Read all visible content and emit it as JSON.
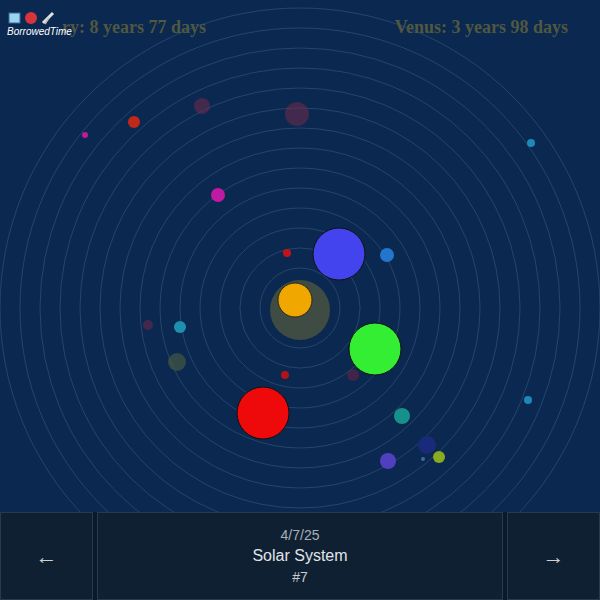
{
  "header": {
    "left_reading": "ry: 8 years 77 days",
    "right_reading": "Venus: 3 years 98 days"
  },
  "logo": {
    "text": "BorrowedTime"
  },
  "planets": [
    {
      "color": "#c0141a",
      "faded": false
    },
    {
      "color": "#b0141a",
      "faded": false
    },
    {
      "color": "#4444ee",
      "faded": false
    },
    {
      "color": "#33ee33",
      "faded": false
    },
    {
      "color": "#2277cc",
      "faded": false
    },
    {
      "color": "#7a2040",
      "faded": true
    },
    {
      "color": "#ee0a0a",
      "faded": false
    },
    {
      "color": "#1f8fb0",
      "faded": false
    },
    {
      "color": "#7a2a48",
      "faded": true
    },
    {
      "color": "#5a6a3a",
      "faded": true
    },
    {
      "color": "#c01aa0",
      "faded": false
    },
    {
      "color": "#15908a",
      "faded": false
    },
    {
      "color": "#1a2a7a",
      "faded": false
    },
    {
      "color": "#5040c0",
      "faded": false
    },
    {
      "color": "#8aaa20",
      "faded": false
    },
    {
      "color": "#3a6aa0",
      "faded": false
    },
    {
      "color": "#c0281a",
      "faded": false
    },
    {
      "color": "#c01a9a",
      "faded": false
    },
    {
      "color": "#7a2a4a",
      "faded": true
    },
    {
      "color": "#7a2a4a",
      "faded": true
    },
    {
      "color": "#1e88b8",
      "faded": false
    },
    {
      "color": "#1e88b8",
      "faded": false
    }
  ],
  "footer": {
    "prev": "←",
    "date": "4/7/25",
    "title": "Solar System",
    "number": "#7",
    "next": "→"
  }
}
